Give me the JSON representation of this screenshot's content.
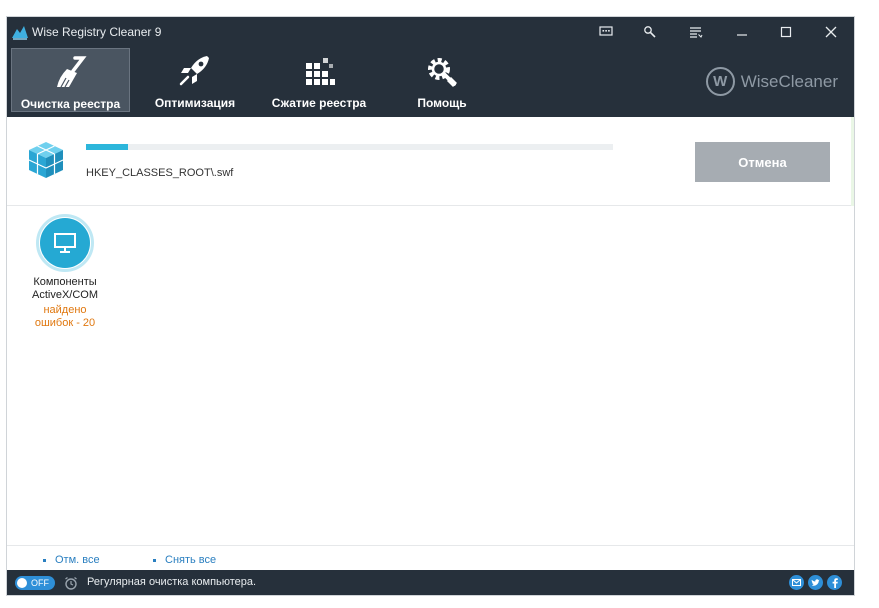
{
  "app": {
    "title": "Wise Registry Cleaner 9"
  },
  "titlebar_icons": [
    "feedback-icon",
    "tools-icon",
    "menu-icon",
    "minimize-icon",
    "maximize-icon",
    "close-icon"
  ],
  "nav": [
    {
      "label": "Очистка реестра",
      "icon": "broom-icon",
      "active": true
    },
    {
      "label": "Оптимизация",
      "icon": "rocket-icon",
      "active": false
    },
    {
      "label": "Сжатие реестра",
      "icon": "compress-icon",
      "active": false
    },
    {
      "label": "Помощь",
      "icon": "gear-wrench-icon",
      "active": false
    }
  ],
  "brand": {
    "logo_letter": "W",
    "name": "WiseCleaner"
  },
  "scan": {
    "progress_percent": 8,
    "current_path": "HKEY_CLASSES_ROOT\\.swf",
    "cancel_label": "Отмена"
  },
  "results": [
    {
      "name_line1": "Компоненты",
      "name_line2": "ActiveX/COM",
      "errors_line1": "найдено",
      "errors_line2": "ошибок - 20"
    }
  ],
  "select": {
    "select_all": "Отм. все",
    "deselect_all": "Снять все"
  },
  "status": {
    "toggle_label": "OFF",
    "text": "Регулярная очистка компьютера.",
    "social": [
      "email-icon",
      "twitter-icon",
      "facebook-icon"
    ]
  },
  "colors": {
    "topbar": "#26303b",
    "accent": "#2cb6db",
    "cancel": "#a6acb2",
    "error": "#e07810",
    "link": "#2a7fc0"
  }
}
